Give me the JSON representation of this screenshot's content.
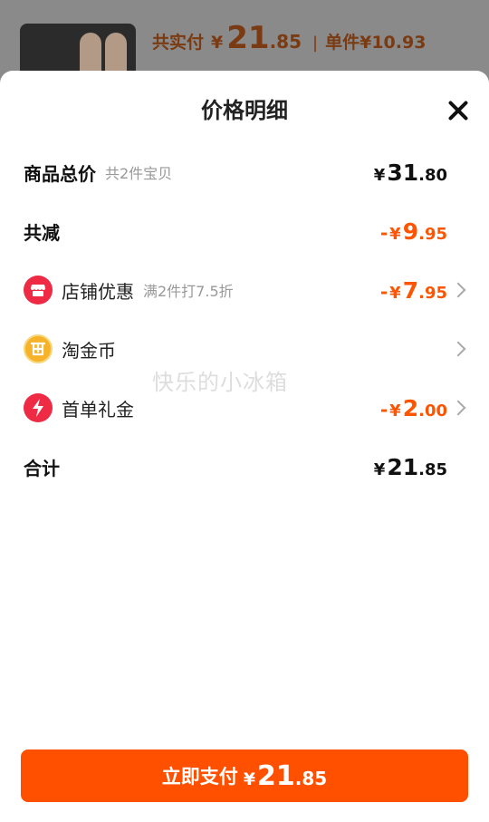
{
  "background_header": {
    "paid_label": "共实付",
    "paid_currency": "¥",
    "paid_int": "21",
    "paid_dec": ".85",
    "separator": "|",
    "unit_label": "单件",
    "unit_price": "¥10.93"
  },
  "sheet": {
    "title": "价格明细",
    "close_icon": "close-icon"
  },
  "rows": {
    "total": {
      "label": "商品总价",
      "sub": "共2件宝贝",
      "currency": "¥",
      "int": "31",
      "dec": ".80"
    },
    "reduction": {
      "label": "共减",
      "minus": "-",
      "currency": "¥",
      "int": "9",
      "dec": ".95"
    },
    "store_discount": {
      "label": "店铺优惠",
      "sub": "满2件打7.5折",
      "minus": "-",
      "currency": "¥",
      "int": "7",
      "dec": ".95",
      "icon": "store-icon"
    },
    "coin": {
      "label": "淘金币",
      "icon": "coin-icon"
    },
    "first_order": {
      "label": "首单礼金",
      "minus": "-",
      "currency": "¥",
      "int": "2",
      "dec": ".00",
      "icon": "lightning-icon"
    },
    "sum": {
      "label": "合计",
      "currency": "¥",
      "int": "21",
      "dec": ".85"
    }
  },
  "watermark": "快乐的小冰箱",
  "pay_button": {
    "label": "立即支付",
    "currency": "¥",
    "int": "21",
    "dec": ".85"
  },
  "colors": {
    "accent": "#ff5000",
    "discount": "#ff5500",
    "store_icon": "#ee2a44",
    "coin_icon": "#f6b32a"
  }
}
